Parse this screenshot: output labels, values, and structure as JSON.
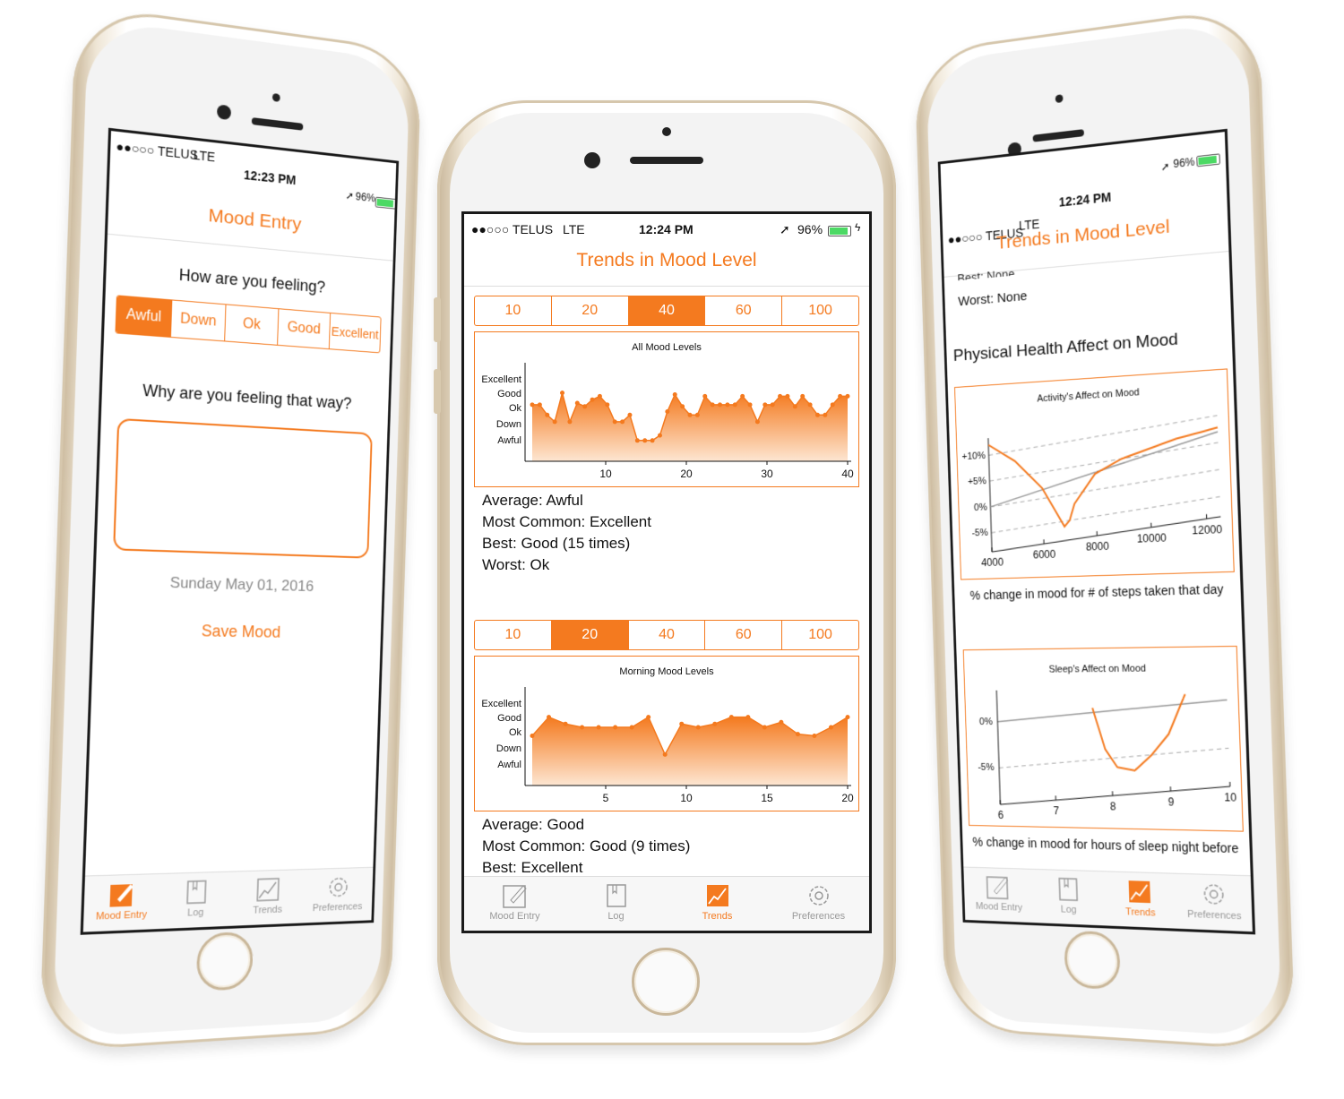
{
  "status": {
    "carrier": "●●○○○ TELUS",
    "network": "LTE",
    "battery": "96%",
    "left_time": "12:23 PM",
    "center_time": "12:24 PM",
    "right_time": "12:24 PM"
  },
  "left_phone": {
    "title": "Mood Entry",
    "question": "How are you feeling?",
    "mood_options": [
      "Awful",
      "Down",
      "Ok",
      "Good",
      "Excellent"
    ],
    "selected_mood": "Awful",
    "reason_label": "Why are you feeling that way?",
    "reason_value": "",
    "date": "Sunday May 01, 2016",
    "save_label": "Save Mood"
  },
  "center_phone": {
    "title": "Trends in Mood Level",
    "range_options": [
      "10",
      "20",
      "40",
      "60",
      "100"
    ],
    "chart1": {
      "selected_range": "40",
      "title": "All Mood Levels",
      "stats": [
        "Average:  Awful",
        "Most Common:  Excellent",
        "Best:  Good (15 times)",
        "Worst:  Ok"
      ]
    },
    "chart2": {
      "selected_range": "20",
      "title": "Morning Mood Levels",
      "stats": [
        "Average:  Good",
        "Most Common:  Good (9 times)",
        "Best:  Excellent"
      ]
    }
  },
  "right_phone": {
    "title": "Trends in Mood Level",
    "cut_text": "Best:  None",
    "worst": "Worst:  None",
    "section_title": "Physical Health Affect on Mood",
    "activity_caption": "% change in mood for # of steps taken that day",
    "sleep_caption": "% change in mood for hours of sleep night before"
  },
  "tabs": [
    "Mood Entry",
    "Log",
    "Trends",
    "Preferences"
  ],
  "colors": {
    "accent": "#f47a1f",
    "battery": "#4cd964"
  },
  "chart_data": [
    {
      "type": "area",
      "title": "All Mood Levels",
      "y_categories": [
        "Awful",
        "Down",
        "Ok",
        "Good",
        "Excellent"
      ],
      "x": [
        1,
        2,
        3,
        4,
        5,
        6,
        7,
        8,
        9,
        10,
        11,
        12,
        13,
        14,
        15,
        16,
        17,
        18,
        19,
        20,
        21,
        22,
        23,
        24,
        25,
        26,
        27,
        28,
        29,
        30,
        31,
        32,
        33,
        34,
        35,
        36,
        37,
        38,
        39,
        40
      ],
      "values": [
        3.9,
        3.9,
        3.3,
        2.9,
        4.6,
        2.9,
        4.0,
        3.8,
        4.2,
        4.4,
        3.9,
        2.9,
        2.9,
        3.3,
        1.8,
        1.8,
        1.8,
        2.1,
        3.5,
        4.5,
        3.8,
        3.3,
        3.3,
        4.4,
        3.9,
        3.9,
        3.9,
        3.9,
        4.4,
        3.9,
        2.9,
        3.9,
        3.9,
        4.4,
        4.4,
        3.8,
        4.4,
        3.9,
        3.3,
        3.3,
        3.9,
        4.4,
        4.4
      ],
      "x_ticks": [
        10,
        20,
        30,
        40
      ],
      "xlim": [
        1,
        40
      ]
    },
    {
      "type": "area",
      "title": "Morning Mood Levels",
      "y_categories": [
        "Awful",
        "Down",
        "Ok",
        "Good",
        "Excellent"
      ],
      "x": [
        1,
        2,
        3,
        4,
        5,
        6,
        7,
        8,
        9,
        10,
        11,
        12,
        13,
        14,
        15,
        16,
        17,
        18,
        19,
        20
      ],
      "values": [
        3.5,
        4.6,
        4.2,
        4.0,
        4.0,
        4.0,
        4.0,
        4.6,
        2.4,
        4.2,
        4.0,
        4.2,
        4.6,
        4.6,
        4.0,
        4.3,
        3.6,
        3.5,
        4.0,
        4.6
      ],
      "x_ticks": [
        5,
        10,
        15,
        20
      ],
      "xlim": [
        1,
        20
      ]
    },
    {
      "type": "line",
      "title": "Activity's Affect on Mood",
      "x_ticks": [
        4000,
        6000,
        8000,
        10000,
        12000
      ],
      "y_ticks": [
        "+10%",
        "+5%",
        "0%",
        "-5%"
      ],
      "xlim": [
        4000,
        12500
      ],
      "series": [
        {
          "x": [
            4000,
            5000,
            6000,
            6800,
            7000,
            7200,
            8000,
            9000,
            10000,
            11000,
            12000,
            12500
          ],
          "values": [
            12,
            8,
            2,
            -6,
            -5,
            -2,
            3,
            5,
            6,
            7,
            7.5,
            7.8
          ]
        },
        {
          "x": [
            4000,
            12500
          ],
          "values": [
            0,
            7
          ]
        }
      ]
    },
    {
      "type": "line",
      "title": "Sleep's Affect on Mood",
      "x_ticks": [
        6,
        7,
        8,
        9,
        10
      ],
      "y_ticks": [
        "0%",
        "-5%"
      ],
      "xlim": [
        6,
        10
      ],
      "series": [
        {
          "x": [
            7.7,
            7.9,
            8.1,
            8.4,
            8.7,
            9.0,
            9.3
          ],
          "values": [
            0.5,
            -4,
            -6,
            -6.5,
            -5,
            -3,
            1
          ]
        },
        {
          "x": [
            6,
            10
          ],
          "values": [
            0,
            0
          ]
        }
      ]
    }
  ]
}
